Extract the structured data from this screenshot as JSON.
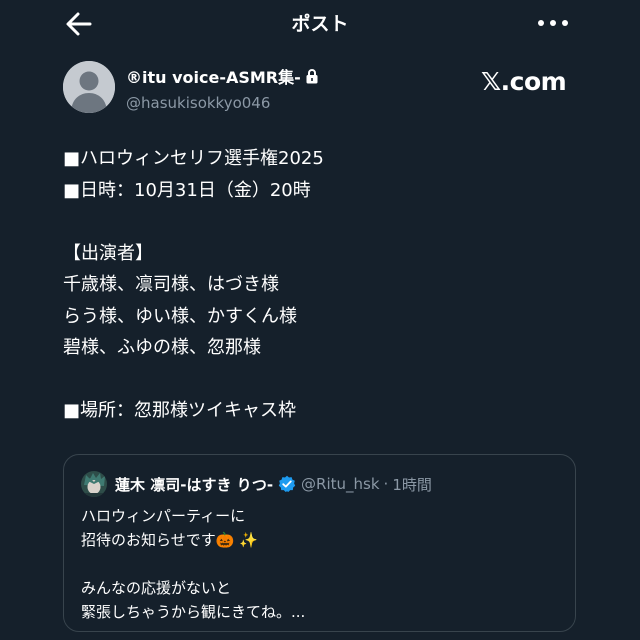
{
  "header": {
    "title": "ポスト",
    "back_icon": "arrow-left-icon",
    "more_icon": "more-horizontal-icon"
  },
  "author": {
    "display_name": "®itu voice-ASMR集-",
    "handle": "@hasukisokkyo046",
    "lock_icon": "lock-icon",
    "avatar_icon": "default-avatar-icon"
  },
  "brand": {
    "logo_text": "𝕏.com"
  },
  "post": {
    "lines": [
      "■ハロウィンセリフ選手権2025",
      "■日時：10月31日（金）20時",
      "",
      "【出演者】",
      "千歳様、凛司様、はづき様",
      "らう様、ゆい様、かすくん様",
      "碧様、ふゆの様、忽那様",
      "",
      "■場所：忽那様ツイキャス枠"
    ]
  },
  "quote": {
    "display_name": "蓮木 凛司-はすき りつ-",
    "handle": "@Ritu_hsk",
    "separator": "·",
    "time": "1時間",
    "verified_icon": "verified-badge-icon",
    "lines": [
      "ハロウィンパーティーに",
      "招待のお知らせです🎃 ✨",
      "",
      "みんなの応援がないと",
      "緊張しちゃうから観にきてね。..."
    ]
  },
  "colors": {
    "background": "#15202b",
    "text": "#ffffff",
    "muted": "#8b98a5",
    "border": "#38444d",
    "verified": "#1d9bf0"
  }
}
